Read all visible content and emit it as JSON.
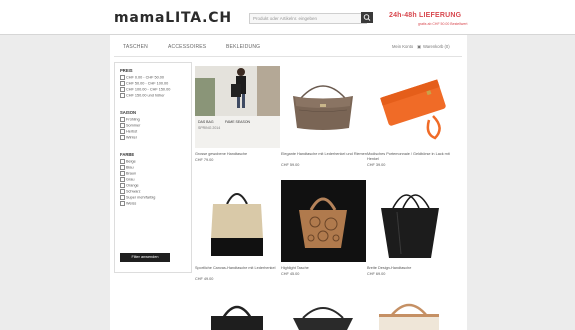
{
  "header": {
    "logo": "mamaLITA.CH",
    "search_placeholder": "Produkt oder Artikelnr. eingeben",
    "delivery": "24h-48h LIEFERUNG",
    "delivery_sub": "gratis ab CHF 50.00 Bestellwert"
  },
  "nav": {
    "items": [
      "TASCHEN",
      "ACCESSOIRES",
      "BEKLEIDUNG"
    ],
    "account": "Mein Konto",
    "cart": "Warenkorb (0)"
  },
  "sidebar": {
    "groups": [
      {
        "title": "PREIS",
        "items": [
          "CHF 0.00 - CHF 50.00",
          "CHF 50.00 - CHF 100.00",
          "CHF 100.00 - CHF 150.00",
          "CHF 150.00 und höher"
        ]
      },
      {
        "title": "SAISON",
        "items": [
          "Frühling",
          "Sommer",
          "Herbst",
          "Winter"
        ]
      },
      {
        "title": "FARBE",
        "items": [
          "Beige",
          "Blau",
          "Braun",
          "Grau",
          "Orange",
          "Schwarz",
          "Super mehrfarbig",
          "Weiss"
        ]
      }
    ],
    "filter_button": "Filter anwenden"
  },
  "products": [
    {
      "caption": "Grosse gewobene Handtasche",
      "price": "CHF 79.00",
      "overlay_left": "DAS BAG",
      "overlay_right": "FAME SEASON",
      "overlay_sub": "SPRING 2014"
    },
    {
      "caption": "Elegante Handtasche mit Lederhenkel und Riemen",
      "price": "CHF 59.00"
    },
    {
      "caption": "Modisches Portemonnaie / Geldbörse in Lack mit Henkel",
      "price": "CHF 39.00"
    },
    {
      "caption": "Sportliche Canvas-Handtasche mit Lederhenkel",
      "price": "CHF 49.00"
    },
    {
      "caption": "Highlight Tasche",
      "price": "CHF 45.00"
    },
    {
      "caption": "Breite Design-Handtasche",
      "price": "CHF 69.00"
    }
  ],
  "colors": {
    "accent": "#d8484f",
    "dark": "#1f1f1f"
  }
}
